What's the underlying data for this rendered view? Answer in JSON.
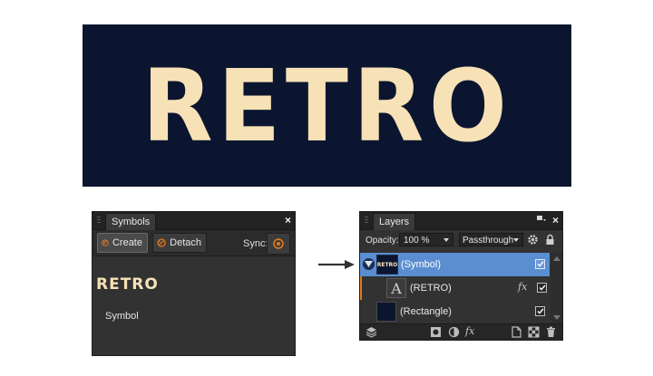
{
  "banner": {
    "text": "RETRO"
  },
  "colors": {
    "banner_bg": "#0c1530",
    "text_cream": "#f6e2b6",
    "accent_orange": "#e07a1c",
    "selection_blue": "#5a8ed0"
  },
  "symbols_panel": {
    "tab_label": "Symbols",
    "close": "×",
    "create_label": "Create",
    "detach_label": "Detach",
    "sync_label": "Sync:",
    "preview_text": "RETRO",
    "symbol_name": "Symbol"
  },
  "layers_panel": {
    "tab_label": "Layers",
    "close": "×",
    "opacity_label": "Opacity:",
    "opacity_value": "100 %",
    "blend_mode": "Passthrough",
    "layers": [
      {
        "name": "(Symbol)",
        "thumb": "RETRO",
        "selected": true,
        "checked": true
      },
      {
        "name": "(RETRO)",
        "thumb": "A",
        "fx": "fx",
        "checked": true
      },
      {
        "name": "(Rectangle)",
        "checked": true
      }
    ],
    "footer_fx": "fx"
  }
}
